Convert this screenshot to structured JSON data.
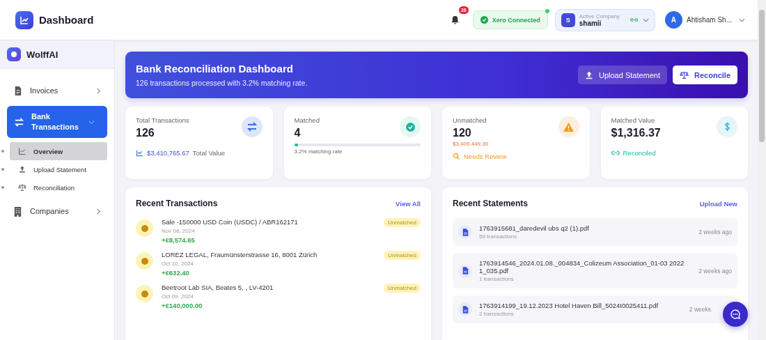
{
  "header": {
    "title": "Dashboard",
    "notification_count": "26",
    "xero": {
      "label": "Xero Connected",
      "connected": true
    },
    "company": {
      "initial": "S",
      "caption": "Active Company",
      "name": "shamii"
    },
    "user": {
      "initial": "A",
      "name": "Ahtisham Sh..."
    }
  },
  "sidebar": {
    "brand": "Wolff**AI**",
    "items": [
      {
        "label": "Invoices",
        "selected": false,
        "expanded": false
      },
      {
        "label": "Bank Transactions",
        "selected": true,
        "expanded": true,
        "children": [
          {
            "label": "Overview",
            "selected": true
          },
          {
            "label": "Upload Statement",
            "selected": false
          },
          {
            "label": "Reconciliation",
            "selected": false
          }
        ]
      },
      {
        "label": "Companies",
        "selected": false,
        "expanded": false
      }
    ]
  },
  "banner": {
    "title": "Bank Reconciliation Dashboard",
    "subtitle": "126 transactions processed with 3.2% matching rate.",
    "buttons": [
      {
        "label": "Upload Statement",
        "kind": "secondary"
      },
      {
        "label": "Reconcile",
        "kind": "primary"
      }
    ]
  },
  "stats": [
    {
      "kind": "total",
      "label": "Total Transactions",
      "value": "126",
      "amount": "$3,410,765.67",
      "note": "Total Value"
    },
    {
      "kind": "matched",
      "label": "Matched",
      "value": "4",
      "level": 0.032,
      "note": "3.2% matching rate"
    },
    {
      "kind": "unmatched",
      "label": "Unmatched",
      "value": "120",
      "amount": "$3,409,449.30",
      "note": "Needs Review"
    },
    {
      "kind": "value",
      "label": "Matched Value",
      "value": "$1,316.37",
      "note": "Reconciled"
    }
  ],
  "transactions": {
    "title": "Recent Transactions",
    "link": "View All",
    "items": [
      {
        "description": "Sale -150000 USD Coin (USDC) / ABR162171",
        "date": "Nov 08, 2024",
        "amount": "+€8,574.65",
        "status": "Unmatched",
        "matched": false
      },
      {
        "description": "LOREZ LEGAL, Fraumünsterstrasse 16, 8001 Zürich",
        "date": "Oct 10, 2024",
        "amount": "+€632.40",
        "status": "Unmatched",
        "matched": false
      },
      {
        "description": "Beetroot Lab SIA, Beates 5, , LV-4201",
        "date": "Oct 09, 2024",
        "amount": "+€140,000.00",
        "status": "Unmatched",
        "matched": false
      }
    ]
  },
  "statements": {
    "title": "Recent Statements",
    "link": "Upload New",
    "items": [
      {
        "file": "1763915681_daredevil ubs q2 (1).pdf",
        "count": "59 transactions",
        "time": "2 weeks ago"
      },
      {
        "file": "1763914546_2024.01.08._004834_Colizeum Association_01-03 2022 1_035.pdf",
        "count": "1 transactions",
        "time": "2 weeks ago"
      },
      {
        "file": "1763914199_19.12.2023 Hotel Haven Bill_5024I0025411.pdf",
        "count": "2 transactions",
        "time": "2 weeks"
      }
    ]
  }
}
